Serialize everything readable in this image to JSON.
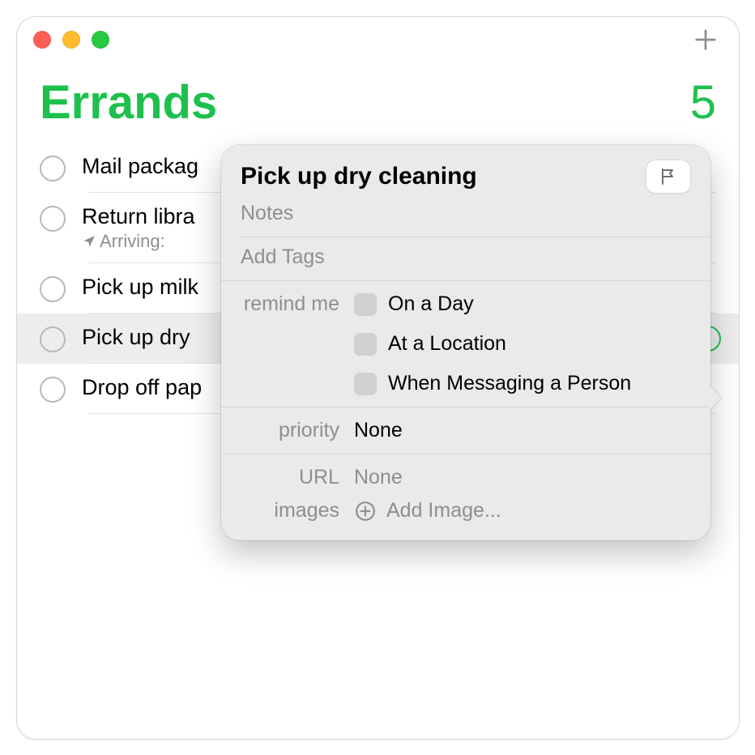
{
  "list": {
    "title": "Errands",
    "count": "5",
    "accent": "#1ec04d"
  },
  "reminders": [
    {
      "title": "Mail packag",
      "subtitle": null
    },
    {
      "title": "Return libra",
      "subtitle": "Arriving:"
    },
    {
      "title": "Pick up milk",
      "subtitle": null
    },
    {
      "title": "Pick up dry",
      "subtitle": null
    },
    {
      "title": "Drop off pap",
      "subtitle": null
    }
  ],
  "selected_index": 3,
  "popover": {
    "title": "Pick up dry cleaning",
    "notes_placeholder": "Notes",
    "tags_placeholder": "Add Tags",
    "remind_label": "remind me",
    "remind_options": {
      "day": "On a Day",
      "location": "At a Location",
      "messaging": "When Messaging a Person"
    },
    "priority_label": "priority",
    "priority_value": "None",
    "url_label": "URL",
    "url_value": "None",
    "images_label": "images",
    "add_image_label": "Add Image..."
  }
}
